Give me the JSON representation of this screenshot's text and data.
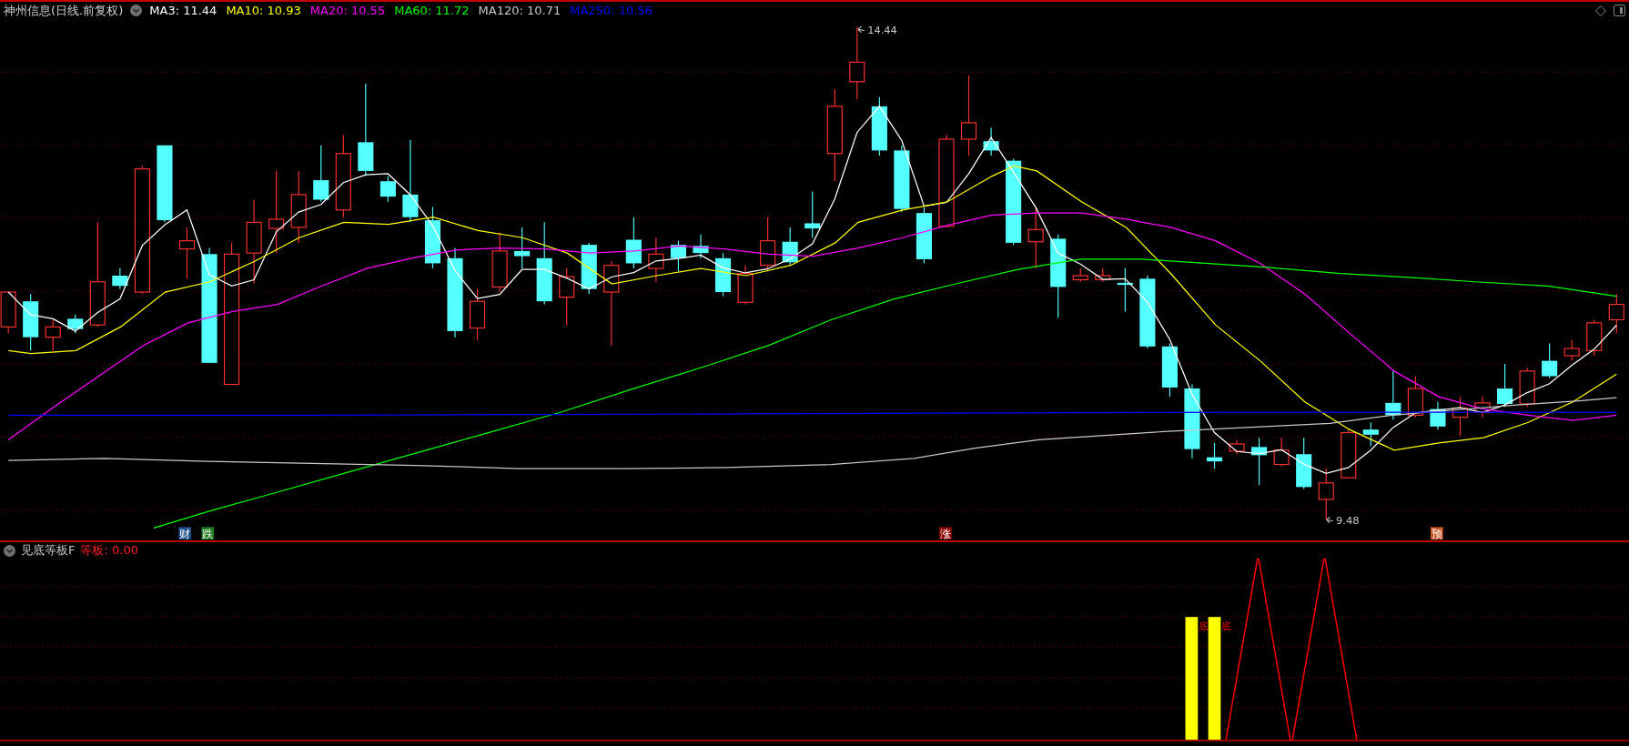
{
  "chart_title": "神州信息(日线.前复权)",
  "ma_legend": [
    {
      "label": "MA3: 11.44",
      "color": "#ffffff"
    },
    {
      "label": "MA10: 10.93",
      "color": "#ffff00"
    },
    {
      "label": "MA20: 10.55",
      "color": "#ff00ff"
    },
    {
      "label": "MA60: 11.72",
      "color": "#00ff00"
    },
    {
      "label": "MA120: 10.71",
      "color": "#c8c8c8"
    },
    {
      "label": "MA250: 10.56",
      "color": "#0000ff"
    }
  ],
  "price_labels": [
    {
      "kind": "high",
      "text": "14.44"
    },
    {
      "kind": "low",
      "text": "9.48"
    }
  ],
  "event_markers": [
    {
      "label": "财",
      "color": "#1f4e8c"
    },
    {
      "label": "跌",
      "color": "#1e7a1e"
    },
    {
      "label": "涨",
      "color": "#8b0000"
    },
    {
      "label": "预",
      "color": "#c8501e"
    }
  ],
  "indicator": {
    "title": "见底等板F",
    "reading": "等板: 0.00",
    "signals": [
      {
        "label": "底"
      },
      {
        "label": "底"
      }
    ]
  }
}
